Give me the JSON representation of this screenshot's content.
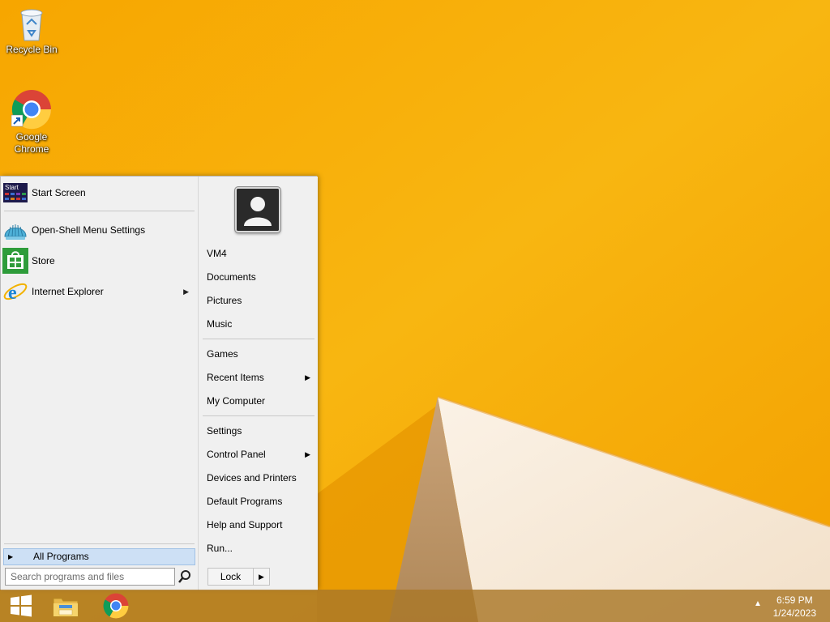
{
  "desktop": {
    "icons": [
      {
        "label": "Recycle Bin",
        "icon": "recycle-bin-icon"
      },
      {
        "label": "Google Chrome",
        "icon": "chrome-icon"
      }
    ]
  },
  "start_menu": {
    "left_items": [
      {
        "label": "Start Screen",
        "icon": "start-screen-icon"
      },
      {
        "label": "Open-Shell Menu Settings",
        "icon": "open-shell-icon"
      },
      {
        "label": "Store",
        "icon": "store-icon"
      },
      {
        "label": "Internet Explorer",
        "icon": "internet-explorer-icon",
        "has_submenu": true
      }
    ],
    "start_tile_text": "Start",
    "all_programs": "All Programs",
    "search_placeholder": "Search programs and files",
    "right_items": [
      {
        "label": "VM4"
      },
      {
        "label": "Documents"
      },
      {
        "label": "Pictures"
      },
      {
        "label": "Music"
      },
      {
        "label": "Games"
      },
      {
        "label": "Recent Items",
        "has_submenu": true
      },
      {
        "label": "My Computer"
      },
      {
        "label": "Settings"
      },
      {
        "label": "Control Panel",
        "has_submenu": true
      },
      {
        "label": "Devices and Printers"
      },
      {
        "label": "Default Programs"
      },
      {
        "label": "Help and Support"
      },
      {
        "label": "Run..."
      }
    ],
    "lock_label": "Lock"
  },
  "taskbar": {
    "items": [
      "windows-start-icon",
      "file-explorer-icon",
      "chrome-icon"
    ],
    "time": "6:59 PM",
    "date": "1/24/2023"
  },
  "colors": {
    "wallpaper": "#f6a800",
    "menu_bg": "#f0f0f0",
    "highlight": "#cde0f5"
  }
}
